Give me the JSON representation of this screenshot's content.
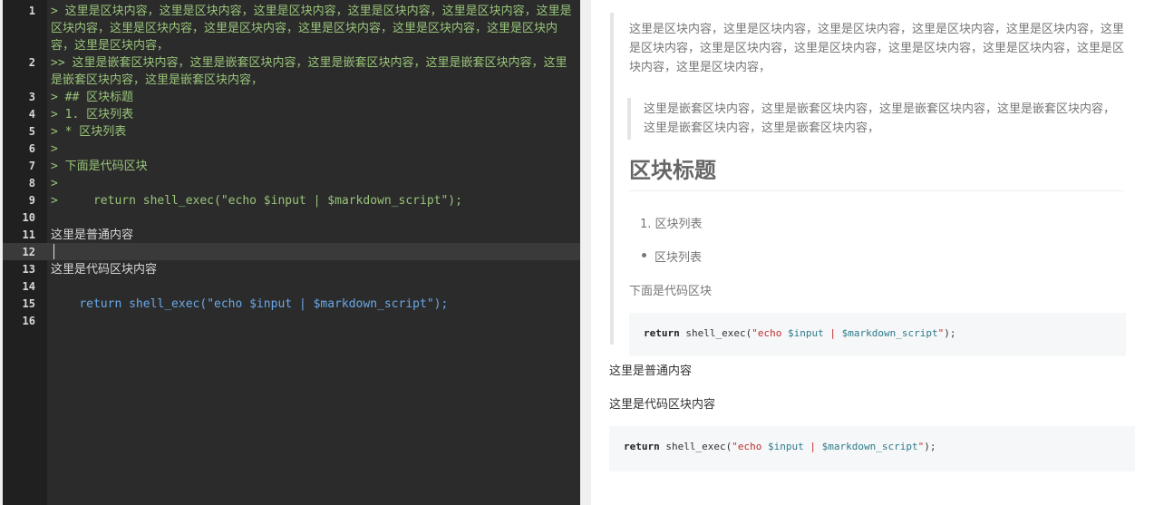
{
  "editor": {
    "line_numbers": [
      "1",
      "2",
      "3",
      "4",
      "5",
      "6",
      "7",
      "8",
      "9",
      "10",
      "11",
      "12",
      "13",
      "14",
      "15",
      "16"
    ],
    "lines": [
      "> 这里是区块内容，这里是区块内容，这里是区块内容，这里是区块内容，这里是区块内容，这里是区块内容，这里是区块内容，这里是区块内容，这里是区块内容，这里是区块内容，这里是区块内容，这里是区块内容，",
      ">> 这里是嵌套区块内容，这里是嵌套区块内容，这里是嵌套区块内容，这里是嵌套区块内容，这里是嵌套区块内容，这里是嵌套区块内容，",
      "> ## 区块标题",
      "> 1. 区块列表",
      "> * 区块列表",
      ">",
      "> 下面是代码区块",
      ">",
      ">     return shell_exec(\"echo $input | $markdown_script\");",
      "",
      "这里是普通内容",
      "",
      "这里是代码区块内容",
      "",
      "    return shell_exec(\"echo $input | $markdown_script\");",
      ""
    ]
  },
  "preview": {
    "blockquote_text": "这里是区块内容，这里是区块内容，这里是区块内容，这里是区块内容，这里是区块内容，这里是区块内容，这里是区块内容，这里是区块内容，这里是区块内容，这里是区块内容，这里是区块内容，这里是区块内容，",
    "nested_blockquote_text": "这里是嵌套区块内容，这里是嵌套区块内容，这里是嵌套区块内容，这里是嵌套区块内容，这里是嵌套区块内容，这里是嵌套区块内容，",
    "heading": "区块标题",
    "ordered_item_marker": "1.",
    "ordered_item": "区块列表",
    "unordered_item": "区块列表",
    "code_intro": "下面是代码区块",
    "code": {
      "keyword": "return",
      "func": " shell_exec(",
      "str_open": "\"echo ",
      "var1": "$input",
      "pipe": " | ",
      "var2": "$markdown_script",
      "str_close": "\"",
      "end": ");"
    },
    "normal_text": "这里是普通内容",
    "code_block_text": "这里是代码区块内容"
  }
}
